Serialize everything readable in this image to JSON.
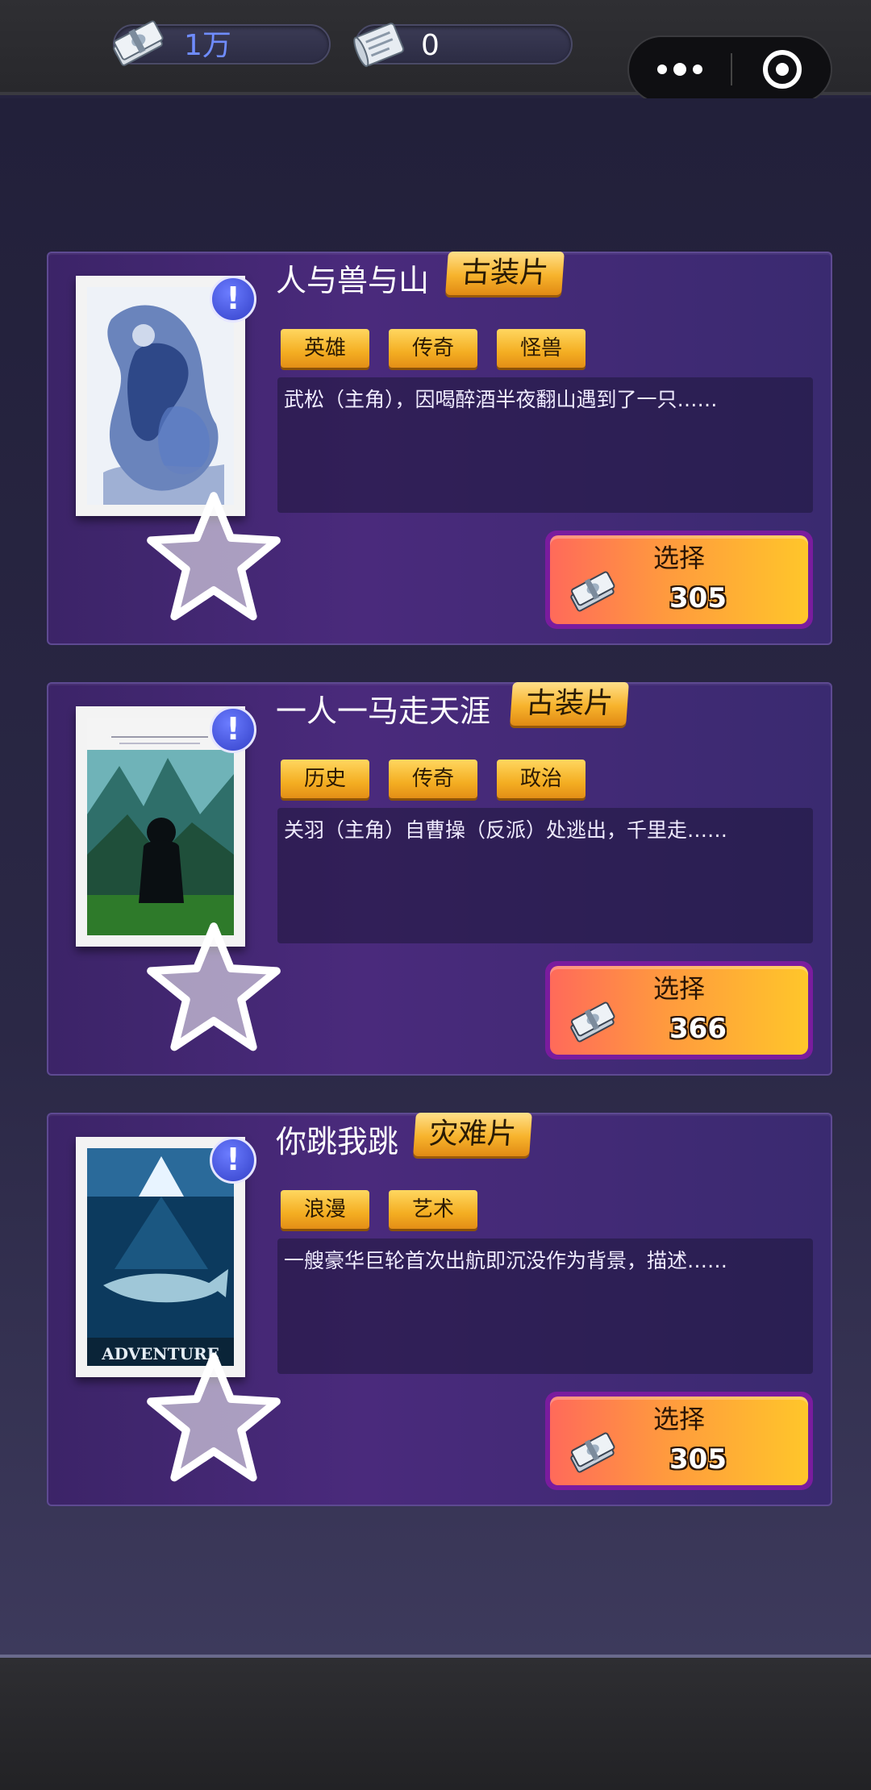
{
  "resources": {
    "money": {
      "icon": "money-stack-icon",
      "value": "1万"
    },
    "tickets": {
      "icon": "ticket-scroll-icon",
      "value": "0"
    }
  },
  "capsule": {
    "more_icon": "more-dots-icon",
    "close_icon": "target-close-icon"
  },
  "movies": [
    {
      "title": "人与兽与山",
      "genre": "古装片",
      "tags": [
        "英雄",
        "传奇",
        "怪兽"
      ],
      "description": "武松（主角），因喝醉酒半夜翻山遇到了一只……",
      "button_label": "选择",
      "price": "305"
    },
    {
      "title": "一人一马走天涯",
      "genre": "古装片",
      "tags": [
        "历史",
        "传奇",
        "政治"
      ],
      "description": "关羽（主角）自曹操（反派）处逃出，千里走……",
      "button_label": "选择",
      "price": "366"
    },
    {
      "title": "你跳我跳",
      "genre": "灾难片",
      "tags": [
        "浪漫",
        "艺术"
      ],
      "description": "一艘豪华巨轮首次出航即沉没作为背景，描述……",
      "button_label": "选择",
      "price": "305"
    }
  ],
  "colors": {
    "accent_gold": "#f7b32c",
    "card_purple": "#4a2a7c",
    "button_border": "#7a1c9e",
    "alert_blue": "#3340c8"
  }
}
